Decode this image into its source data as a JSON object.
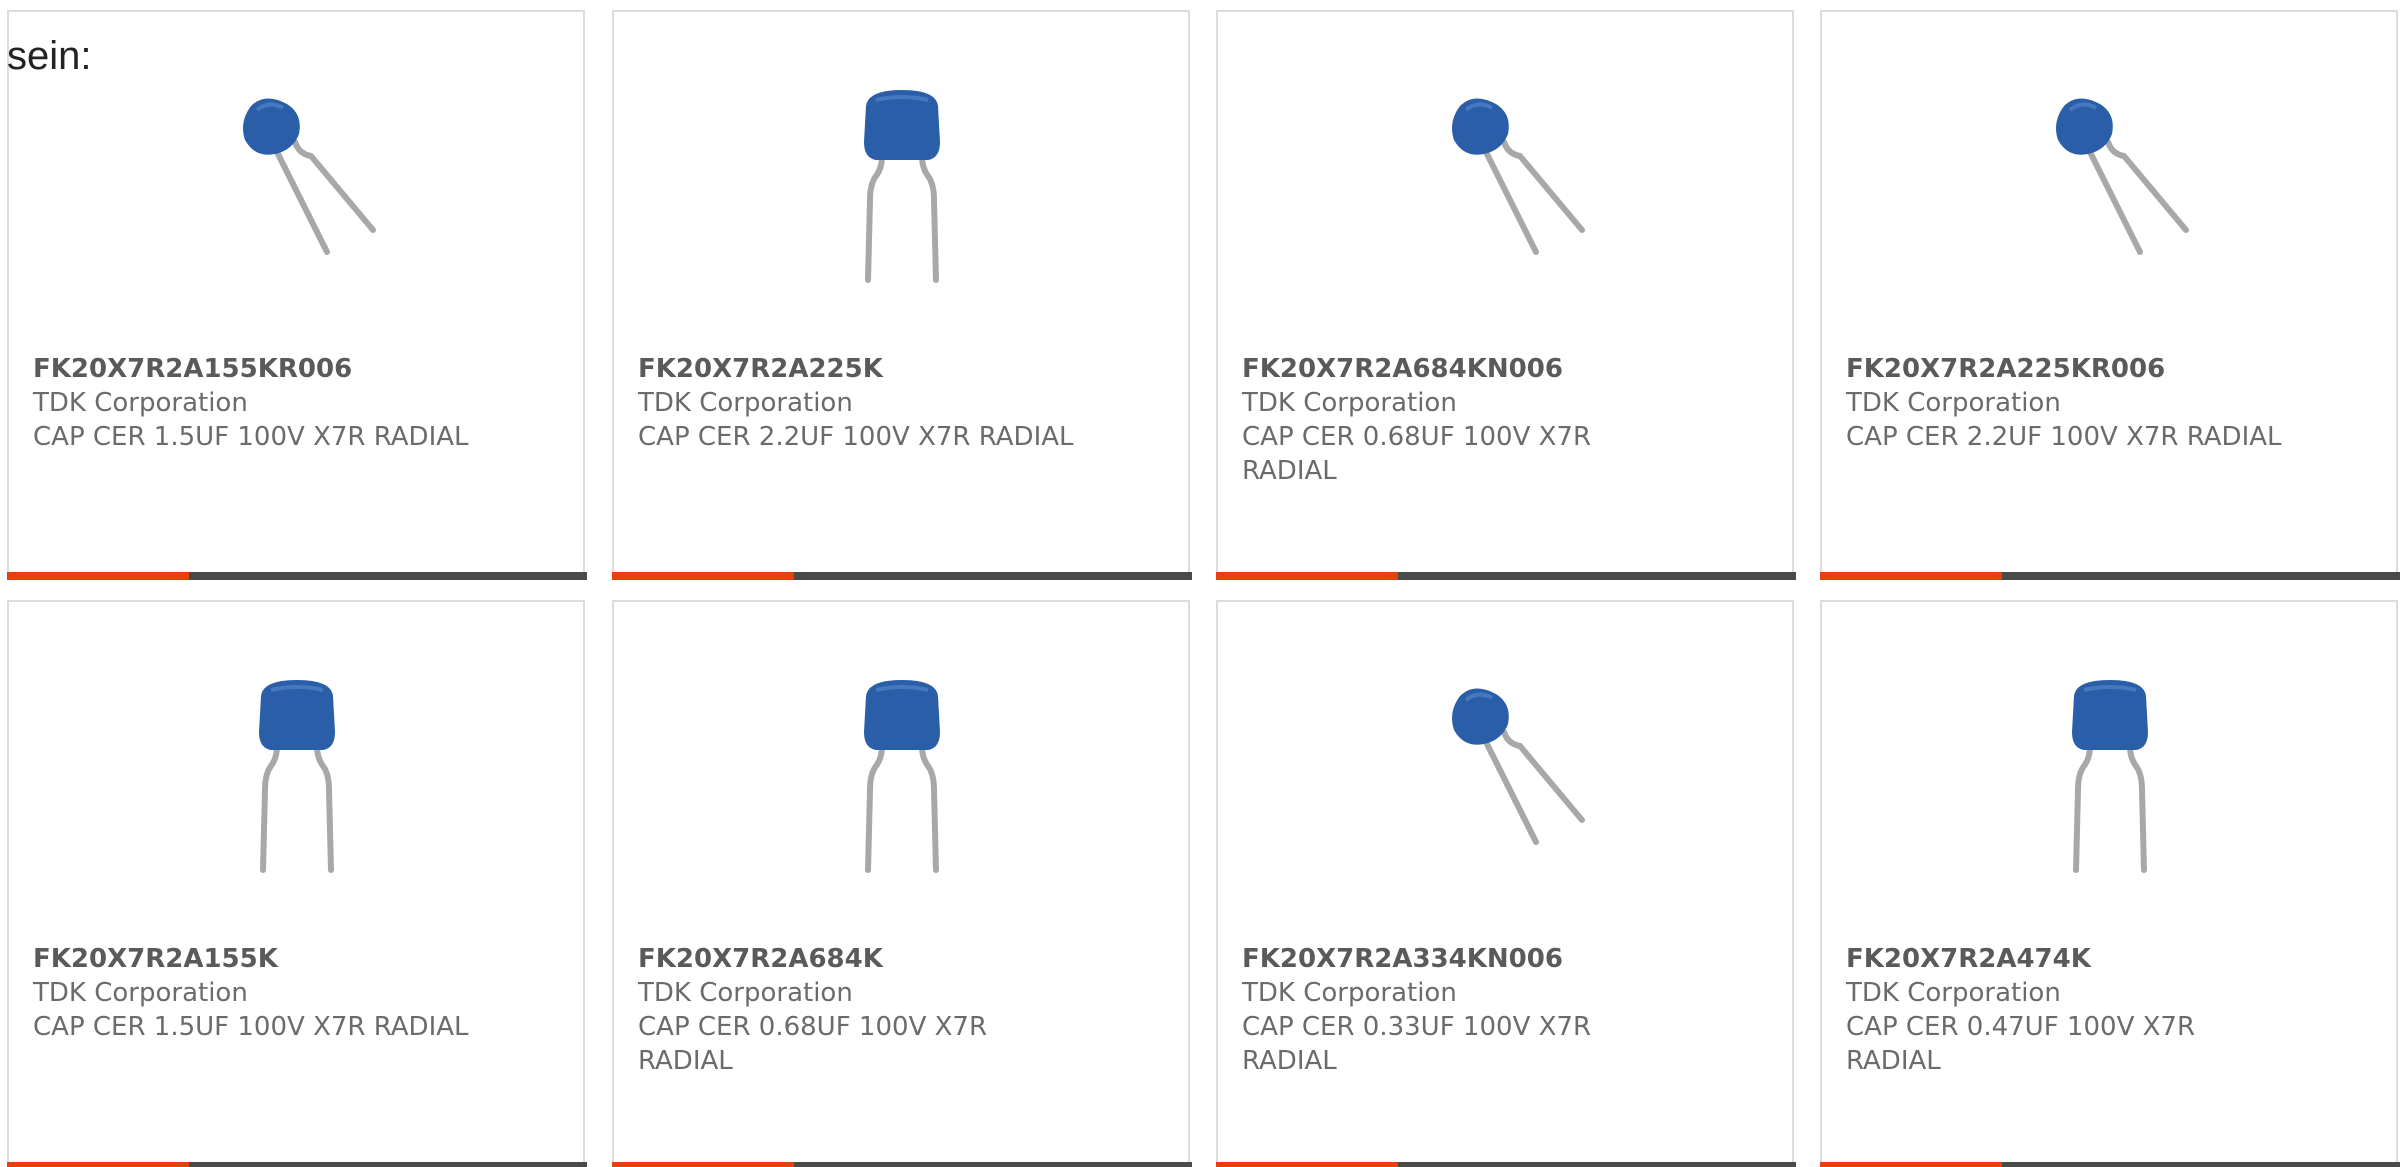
{
  "intro_text": "sein:",
  "colors": {
    "accent": "#e8400c",
    "bar": "#4a4a4a",
    "capacitor": "#2a5ea8",
    "lead": "#a8a8a8"
  },
  "products": [
    {
      "part_number": "FK20X7R2A155KR006",
      "manufacturer": "TDK Corporation",
      "description": "CAP CER 1.5UF 100V X7R RADIAL",
      "image_icon": "capacitor-tilted-icon"
    },
    {
      "part_number": "FK20X7R2A225K",
      "manufacturer": "TDK Corporation",
      "description": "CAP CER 2.2UF 100V X7R RADIAL",
      "image_icon": "capacitor-upright-icon"
    },
    {
      "part_number": "FK20X7R2A684KN006",
      "manufacturer": "TDK Corporation",
      "description": "CAP CER 0.68UF 100V X7R RADIAL",
      "image_icon": "capacitor-tilted-icon"
    },
    {
      "part_number": "FK20X7R2A225KR006",
      "manufacturer": "TDK Corporation",
      "description": "CAP CER 2.2UF 100V X7R RADIAL",
      "image_icon": "capacitor-tilted-icon"
    },
    {
      "part_number": "FK20X7R2A155K",
      "manufacturer": "TDK Corporation",
      "description": "CAP CER 1.5UF 100V X7R RADIAL",
      "image_icon": "capacitor-upright-icon"
    },
    {
      "part_number": "FK20X7R2A684K",
      "manufacturer": "TDK Corporation",
      "description": "CAP CER 0.68UF 100V X7R RADIAL",
      "image_icon": "capacitor-upright-icon"
    },
    {
      "part_number": "FK20X7R2A334KN006",
      "manufacturer": "TDK Corporation",
      "description": "CAP CER 0.33UF 100V X7R RADIAL",
      "image_icon": "capacitor-tilted-icon"
    },
    {
      "part_number": "FK20X7R2A474K",
      "manufacturer": "TDK Corporation",
      "description": "CAP CER 0.47UF 100V X7R RADIAL",
      "image_icon": "capacitor-upright-icon"
    }
  ]
}
